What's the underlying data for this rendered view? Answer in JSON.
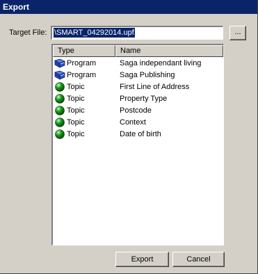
{
  "window": {
    "title": "Export"
  },
  "target": {
    "label": "Target File:",
    "value": "\\SMART_04292014.upf",
    "browse_label": "..."
  },
  "list": {
    "columns": [
      "Type",
      "Name"
    ],
    "rows": [
      {
        "type": "Program",
        "name": "Saga independant living",
        "icon": "program-book-icon"
      },
      {
        "type": "Program",
        "name": "Saga Publishing",
        "icon": "program-book-icon"
      },
      {
        "type": "Topic",
        "name": "First Line of Address",
        "icon": "topic-green-ball-icon"
      },
      {
        "type": "Topic",
        "name": "Property Type",
        "icon": "topic-green-ball-icon"
      },
      {
        "type": "Topic",
        "name": "Postcode",
        "icon": "topic-green-ball-icon"
      },
      {
        "type": "Topic",
        "name": "Context",
        "icon": "topic-green-ball-icon"
      },
      {
        "type": "Topic",
        "name": "Date of birth",
        "icon": "topic-green-ball-icon"
      }
    ]
  },
  "buttons": {
    "export_label": "Export",
    "cancel_label": "Cancel"
  },
  "colors": {
    "titlebar": "#0a246a",
    "dialog_bg": "#d4d0c8",
    "topic_icon": "#1a9a1a",
    "program_icon": "#1f3fb0"
  }
}
